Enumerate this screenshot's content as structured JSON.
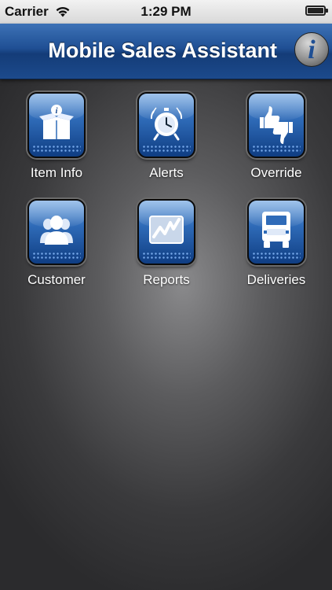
{
  "status_bar": {
    "carrier": "Carrier",
    "time": "1:29 PM",
    "wifi_icon": "wifi-icon",
    "battery_icon": "battery-icon"
  },
  "nav_bar": {
    "title": "Mobile Sales Assistant",
    "info_button_glyph": "i",
    "info_icon": "info-icon"
  },
  "menu": {
    "items": [
      {
        "label": "Item Info",
        "icon": "box-info-icon"
      },
      {
        "label": "Alerts",
        "icon": "alarm-clock-icon"
      },
      {
        "label": "Override",
        "icon": "thumbs-up-down-icon"
      },
      {
        "label": "Customer",
        "icon": "customer-icon"
      },
      {
        "label": "Reports",
        "icon": "chart-icon"
      },
      {
        "label": "Deliveries",
        "icon": "truck-icon"
      }
    ]
  },
  "colors": {
    "nav_blue": "#1f4f94",
    "icon_blue": "#2f6bb8",
    "background_dark": "#3a3a3c"
  }
}
